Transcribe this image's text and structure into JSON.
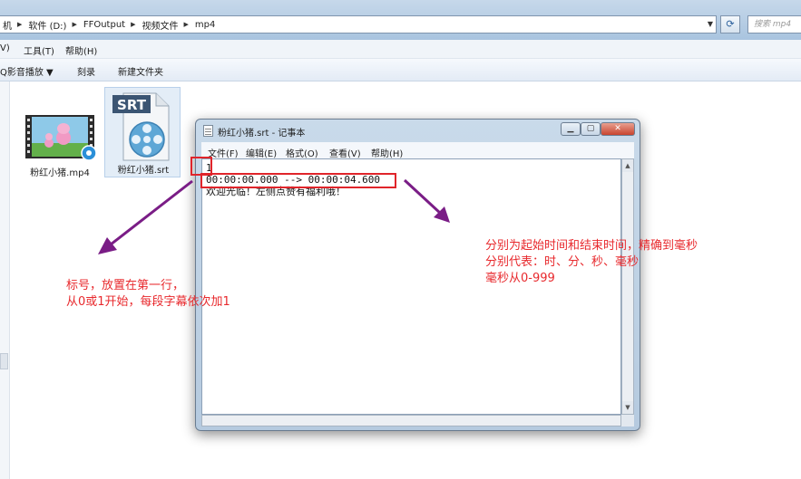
{
  "address_bar": {
    "crumbs": [
      "机",
      "软件 (D:)",
      "FFOutput",
      "视频文件",
      "mp4"
    ],
    "search_placeholder": "搜索 mp4"
  },
  "menubar": {
    "items": [
      "V)",
      "工具(T)",
      "帮助(H)"
    ]
  },
  "toolbar": {
    "items": [
      "Q影音播放 ▼",
      "刻录",
      "新建文件夹"
    ]
  },
  "files": [
    {
      "name": "粉红小猪.mp4",
      "icon": "video-thumbnail-icon"
    },
    {
      "name": "粉红小猪.srt",
      "icon": "srt-file-icon",
      "badge": "SRT"
    }
  ],
  "notepad": {
    "title": "粉红小猪.srt - 记事本",
    "menu": [
      "文件(F)",
      "编辑(E)",
      "格式(O)",
      "查看(V)",
      "帮助(H)"
    ],
    "lines": [
      "1",
      "00:00:00.000 --> 00:00:04.600",
      "欢迎光临！左侧点赞有福利哦！"
    ]
  },
  "annotations": {
    "left_note": [
      "标号，放置在第一行，",
      "从0或1开始，每段字幕依次加1"
    ],
    "right_note": [
      "分别为起始时间和结束时间，精确到毫秒",
      "分别代表：时、分、秒、毫秒",
      "毫秒从0-999"
    ]
  },
  "colors": {
    "annotation_red": "#e0242a",
    "arrow_purple": "#7a1d86",
    "window_frame": "#b5cadf"
  }
}
